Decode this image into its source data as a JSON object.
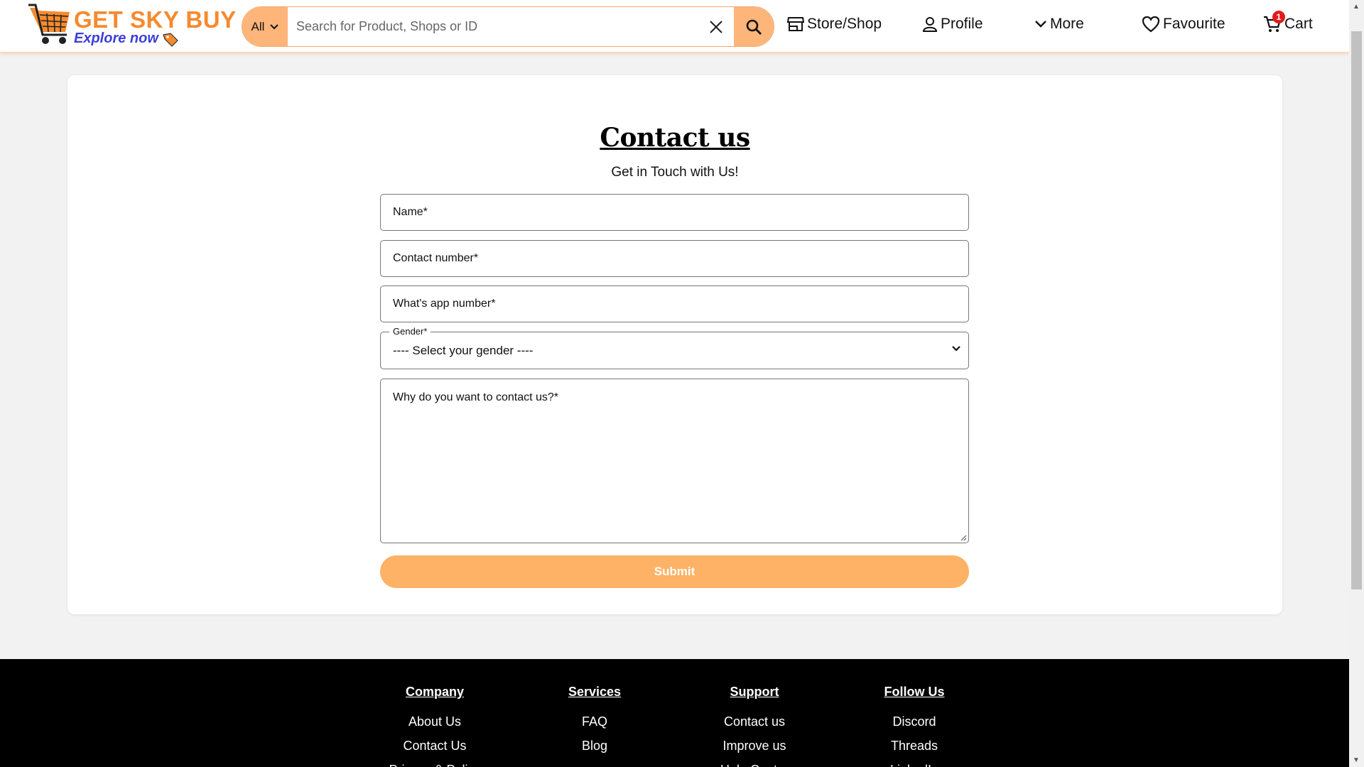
{
  "brand": {
    "title": "GET SKY BUY",
    "tagline": "Explore now",
    "colors": {
      "primary": "#f68a2e",
      "accent": "#3c3fd6",
      "button": "#fdb266"
    }
  },
  "search": {
    "category": "All",
    "placeholder": "Search for Product, Shops or ID",
    "value": ""
  },
  "nav": {
    "store": "Store/Shop",
    "profile": "Profile",
    "more": "More",
    "favourite": "Favourite",
    "cart": "Cart",
    "cart_count": "1"
  },
  "contact": {
    "title": "Contact us",
    "subtitle": "Get in Touch with Us!",
    "name_placeholder": "Name*",
    "contact_placeholder": "Contact number*",
    "whatsapp_placeholder": "What's app number*",
    "gender_label": "Gender*",
    "gender_selected": "---- Select your gender ----",
    "message_placeholder": "Why do you want to contact us?*",
    "submit_label": "Submit"
  },
  "footer": {
    "columns": [
      {
        "heading": "Company",
        "links": [
          "About Us",
          "Contact Us",
          "Privacy & Policy"
        ]
      },
      {
        "heading": "Services",
        "links": [
          "FAQ",
          "Blog"
        ]
      },
      {
        "heading": "Support",
        "links": [
          "Contact us",
          "Improve us",
          "Help Center"
        ]
      },
      {
        "heading": "Follow Us",
        "links": [
          "Discord",
          "Threads",
          "LinkedIn"
        ]
      }
    ]
  }
}
